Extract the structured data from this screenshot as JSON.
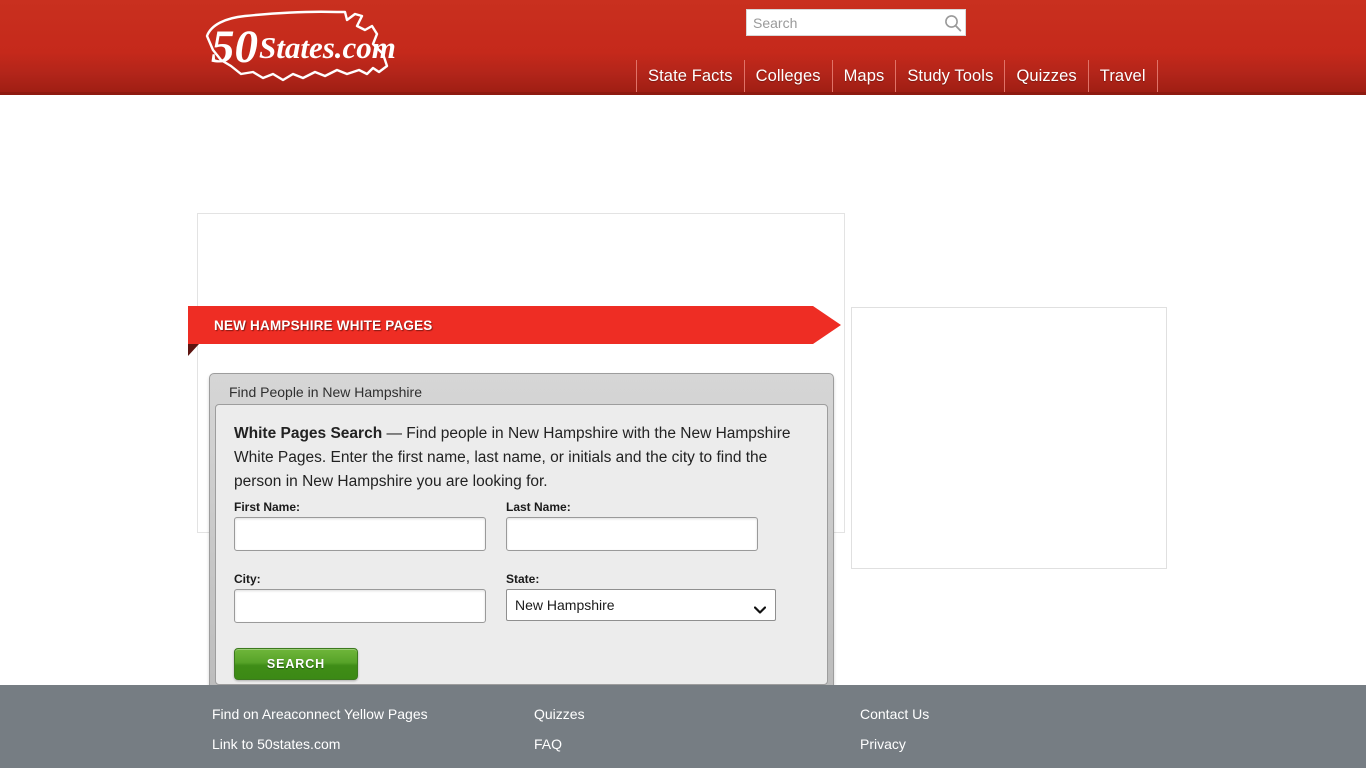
{
  "header": {
    "logo": {
      "text_primary": "50",
      "text_secondary": "States.com",
      "icon": "us-map-outline-icon"
    },
    "search": {
      "placeholder": "Search",
      "value": "",
      "icon": "search-icon"
    },
    "nav": [
      {
        "label": "State Facts"
      },
      {
        "label": "Colleges"
      },
      {
        "label": "Maps"
      },
      {
        "label": "Study Tools"
      },
      {
        "label": "Quizzes"
      },
      {
        "label": "Travel"
      }
    ],
    "colors": {
      "brand_red": "#c5291b",
      "brand_red_dark": "#9c1d12"
    }
  },
  "main": {
    "ribbon_title": "NEW HAMPSHIRE WHITE PAGES",
    "module_title": "Find People in New Hampshire",
    "intro": {
      "bold": "White Pages Search",
      "rest": " — Find people in New Hampshire with the New Hampshire White Pages. Enter the first name, last name, or initials and the city to find the person in New Hampshire you are looking for."
    },
    "form": {
      "first_name": {
        "label": "First Name:",
        "value": "",
        "placeholder": ""
      },
      "last_name": {
        "label": "Last Name:",
        "value": "",
        "placeholder": ""
      },
      "city": {
        "label": "City:",
        "value": "",
        "placeholder": ""
      },
      "state": {
        "label": "State:",
        "value": "New Hampshire",
        "icon": "chevron-down-icon"
      },
      "submit_label": "SEARCH"
    },
    "accent_colors": {
      "ribbon_red": "#ee2d24",
      "button_green": "#4ea227"
    }
  },
  "sidebar": {
    "slot_label": ""
  },
  "footer": {
    "columns": [
      {
        "links": [
          {
            "label": "Find on Areaconnect Yellow Pages"
          },
          {
            "label": "Link to 50states.com"
          }
        ]
      },
      {
        "links": [
          {
            "label": "Quizzes"
          },
          {
            "label": "FAQ"
          }
        ]
      },
      {
        "links": [
          {
            "label": "Contact Us"
          },
          {
            "label": "Privacy"
          }
        ]
      }
    ],
    "background": "#767d83"
  }
}
